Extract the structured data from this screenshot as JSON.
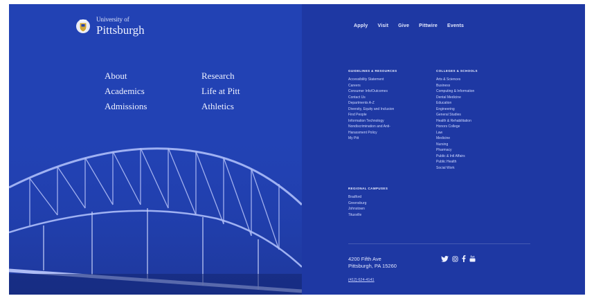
{
  "brand": {
    "line1": "University of",
    "line2": "Pittsburgh"
  },
  "main_nav": [
    "About",
    "Research",
    "Academics",
    "Life at Pitt",
    "Admissions",
    "Athletics"
  ],
  "top_links": [
    "Apply",
    "Visit",
    "Give",
    "Pittwire",
    "Events"
  ],
  "guidelines": {
    "heading": "GUIDELINES & RESOURCES",
    "items": [
      "Accessibility Statement",
      "Careers",
      "Consumer Info/Outcomes",
      "Contact Us",
      "Departments A-Z",
      "Diversity, Equity and Inclusion",
      "Find People",
      "Information Technology",
      "Nondiscrimination and Anti-",
      "Harassment Policy",
      "My Pitt"
    ]
  },
  "regional": {
    "heading": "REGIONAL CAMPUSES",
    "items": [
      "Bradford",
      "Greensburg",
      "Johnstown",
      "Titusville"
    ]
  },
  "schools": {
    "heading": "COLLEGES & SCHOOLS",
    "items": [
      "Arts & Sciences",
      "Business",
      "Computing & Information",
      "Dental Medicine",
      "Education",
      "Engineering",
      "General Studies",
      "Health & Rehabilitation",
      "Honors College",
      "Law",
      "Medicine",
      "Nursing",
      "Pharmacy",
      "Public & Intl Affairs",
      "Public Health",
      "Social Work"
    ]
  },
  "address": {
    "line1": "4200 Fifth Ave",
    "line2": "Pittsburgh, PA 15260",
    "phone": "(412) 624-4141"
  },
  "social": [
    "twitter-icon",
    "instagram-icon",
    "facebook-icon",
    "youtube-icon"
  ],
  "colors": {
    "left_bg": "#2242b4",
    "right_bg": "#1e38a3"
  }
}
